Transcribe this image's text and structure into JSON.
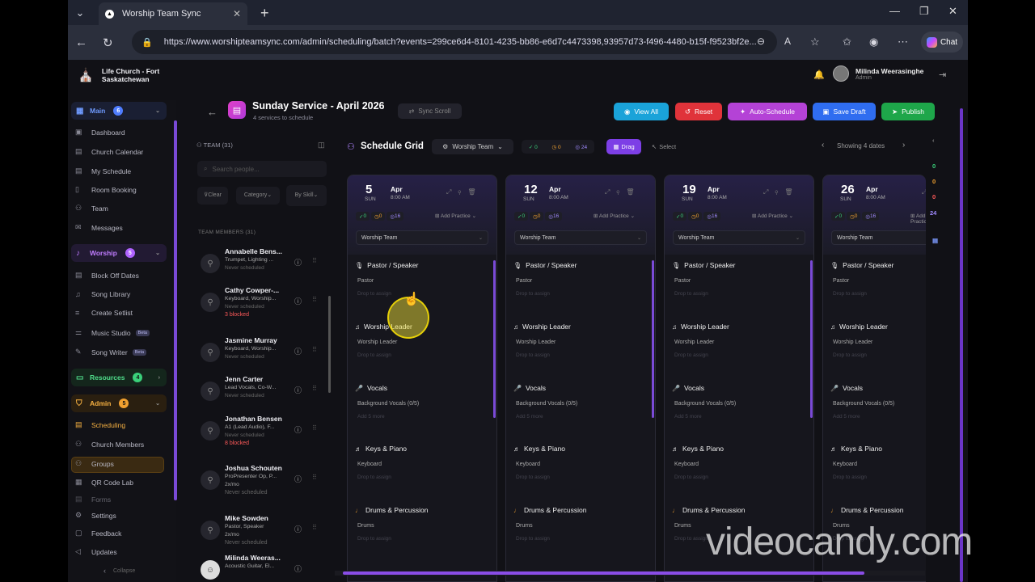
{
  "browser": {
    "tab_title": "Worship Team Sync",
    "url": "https://www.worshipteamsync.com/admin/scheduling/batch?events=299ce6d4-8101-4235-bb86-e6d7c4473398,93957d73-f496-4480-b15f-f9523bf2e...",
    "chat_label": "Chat"
  },
  "app": {
    "church_name_line1": "Life Church - Fort",
    "church_name_line2": "Saskatchewan",
    "user_name": "Milinda Weerasinghe",
    "user_role": "Admin"
  },
  "sidebar": {
    "sections": [
      {
        "label": "Main",
        "badge": "6",
        "color": "#4f7dff"
      },
      {
        "label": "Worship",
        "badge": "5",
        "color": "#b063ff"
      },
      {
        "label": "Resources",
        "badge": "4",
        "color": "#3ad07a"
      },
      {
        "label": "Admin",
        "badge": "5",
        "color": "#f0a030"
      }
    ],
    "main_items": [
      "Dashboard",
      "Church Calendar",
      "My Schedule",
      "Room Booking",
      "Team",
      "Messages"
    ],
    "worship_items": [
      "Block Off Dates",
      "Song Library",
      "Create Setlist",
      "Music Studio",
      "Song Writer"
    ],
    "beta_label": "Beta",
    "admin_items": [
      "Scheduling",
      "Church Members",
      "Groups",
      "QR Code Lab",
      "Forms"
    ],
    "footer_items": [
      "Settings",
      "Feedback",
      "Updates"
    ],
    "collapse_label": "Collapse"
  },
  "header": {
    "title": "Sunday Service - April 2026",
    "subtitle": "4 services to schedule",
    "sync_scroll": "Sync Scroll",
    "buttons": [
      {
        "label": "View All",
        "color": "#1aa3d9"
      },
      {
        "label": "Reset",
        "color": "#e0333a"
      },
      {
        "label": "Auto-Schedule",
        "color": "#b442d6"
      },
      {
        "label": "Save Draft",
        "color": "#2f6df0"
      },
      {
        "label": "Publish",
        "color": "#1ea64a"
      }
    ]
  },
  "team": {
    "header": "TEAM (31)",
    "search_placeholder": "Search people...",
    "clear": "Clear",
    "category": "Category",
    "by_skill": "By Skill",
    "members_header": "TEAM MEMBERS (31)",
    "members": [
      {
        "name": "Annabelle Bens...",
        "roles": "Trumpet, Lighting ...",
        "status": "Never scheduled",
        "blocked": ""
      },
      {
        "name": "Cathy Cowper-...",
        "roles": "Keyboard, Worship...",
        "status": "Never scheduled",
        "blocked": "3 blocked"
      },
      {
        "name": "Jasmine Murray",
        "roles": "Keyboard, Worship...",
        "status": "Never scheduled",
        "blocked": ""
      },
      {
        "name": "Jenn Carter",
        "roles": "Lead Vocals, Co-W...",
        "status": "Never scheduled",
        "blocked": ""
      },
      {
        "name": "Jonathan Bensen",
        "roles": "A1 (Lead Audio), F...",
        "status": "Never scheduled",
        "blocked": "8 blocked"
      },
      {
        "name": "Joshua Schouten",
        "roles": "ProPresenter Op, P...",
        "status": "2x/mo",
        "blocked": "Never scheduled"
      },
      {
        "name": "Mike Sowden",
        "roles": "Pastor, Speaker",
        "status": "2x/mo",
        "blocked": "Never scheduled"
      },
      {
        "name": "Milinda Weeras...",
        "roles": "Acoustic Guitar, El...",
        "status": "",
        "blocked": ""
      }
    ]
  },
  "grid": {
    "title": "Schedule Grid",
    "team_select": "Worship Team",
    "stats": {
      "ok": "0",
      "warn": "0",
      "total": "24"
    },
    "drag": "Drag",
    "select": "Select",
    "showing": "Showing 4 dates",
    "add_practice": "Add Practice",
    "team_dropdown": "Worship Team",
    "days": [
      {
        "day": "5",
        "dow": "SUN",
        "month": "Apr",
        "time": "8:00 AM"
      },
      {
        "day": "12",
        "dow": "SUN",
        "month": "Apr",
        "time": "8:00 AM"
      },
      {
        "day": "19",
        "dow": "SUN",
        "month": "Apr",
        "time": "8:00 AM"
      },
      {
        "day": "26",
        "dow": "SUN",
        "month": "Apr",
        "time": "8:00 AM"
      }
    ],
    "day_stats": {
      "ok": "0",
      "warn": "0",
      "total": "16"
    },
    "roles": [
      {
        "title": "Pastor / Speaker",
        "slot": "Pastor",
        "drop": "Drop to assign"
      },
      {
        "title": "Worship Leader",
        "slot": "Worship Leader",
        "drop": "Drop to assign"
      },
      {
        "title": "Vocals",
        "slot": "Background Vocals (0/5)",
        "drop": "Add 5 more"
      },
      {
        "title": "Keys & Piano",
        "slot": "Keyboard",
        "drop": "Drop to assign"
      },
      {
        "title": "Drums & Percussion",
        "slot": "Drums",
        "drop": "Drop to assign"
      }
    ],
    "rail_values": [
      "0",
      "0",
      "0",
      "24"
    ]
  },
  "watermark": "videocandy.com"
}
